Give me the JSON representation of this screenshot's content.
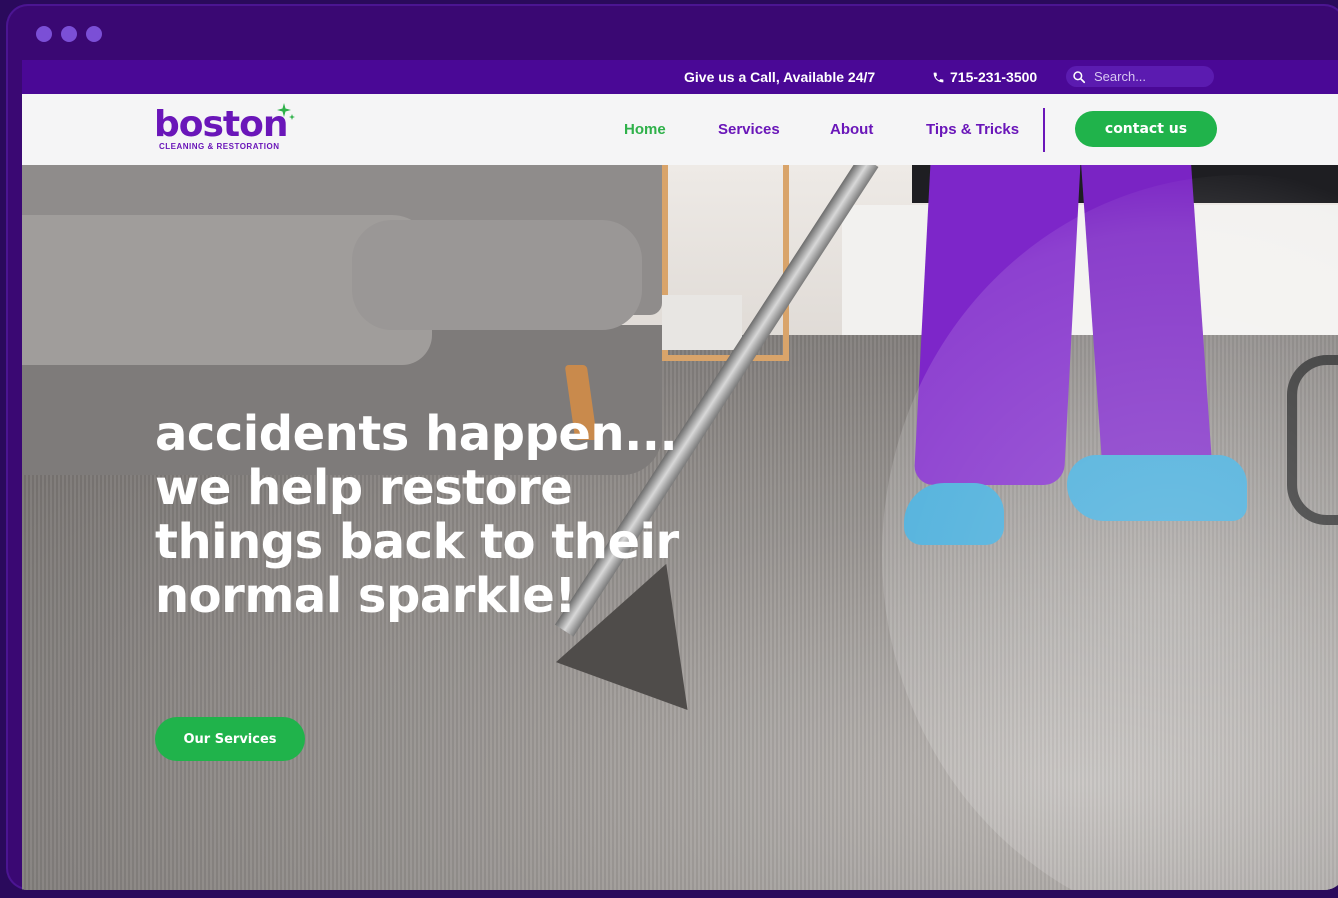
{
  "topbar": {
    "call_text": "Give us a Call, Available 24/7",
    "phone": "715-231-3500",
    "search_placeholder": "Search..."
  },
  "nav": {
    "logo_word": "boston",
    "logo_sub": "CLEANING & RESTORATION",
    "links": [
      {
        "label": "Home",
        "active": true
      },
      {
        "label": "Services"
      },
      {
        "label": "About"
      },
      {
        "label": "Tips & Tricks"
      }
    ],
    "contact_label": "contact us"
  },
  "hero": {
    "headline_lines": [
      "accidents happen...",
      "we help restore",
      "things back to their",
      "normal sparkle!"
    ],
    "cta_label": "Our Services"
  },
  "colors": {
    "brand_purple": "#6a16b9",
    "topbar_purple": "#4a0896",
    "accent_green": "#20b34b",
    "frame": "#3a0873"
  },
  "icons": [
    "phone-icon",
    "search-icon",
    "sparkle-icon"
  ]
}
